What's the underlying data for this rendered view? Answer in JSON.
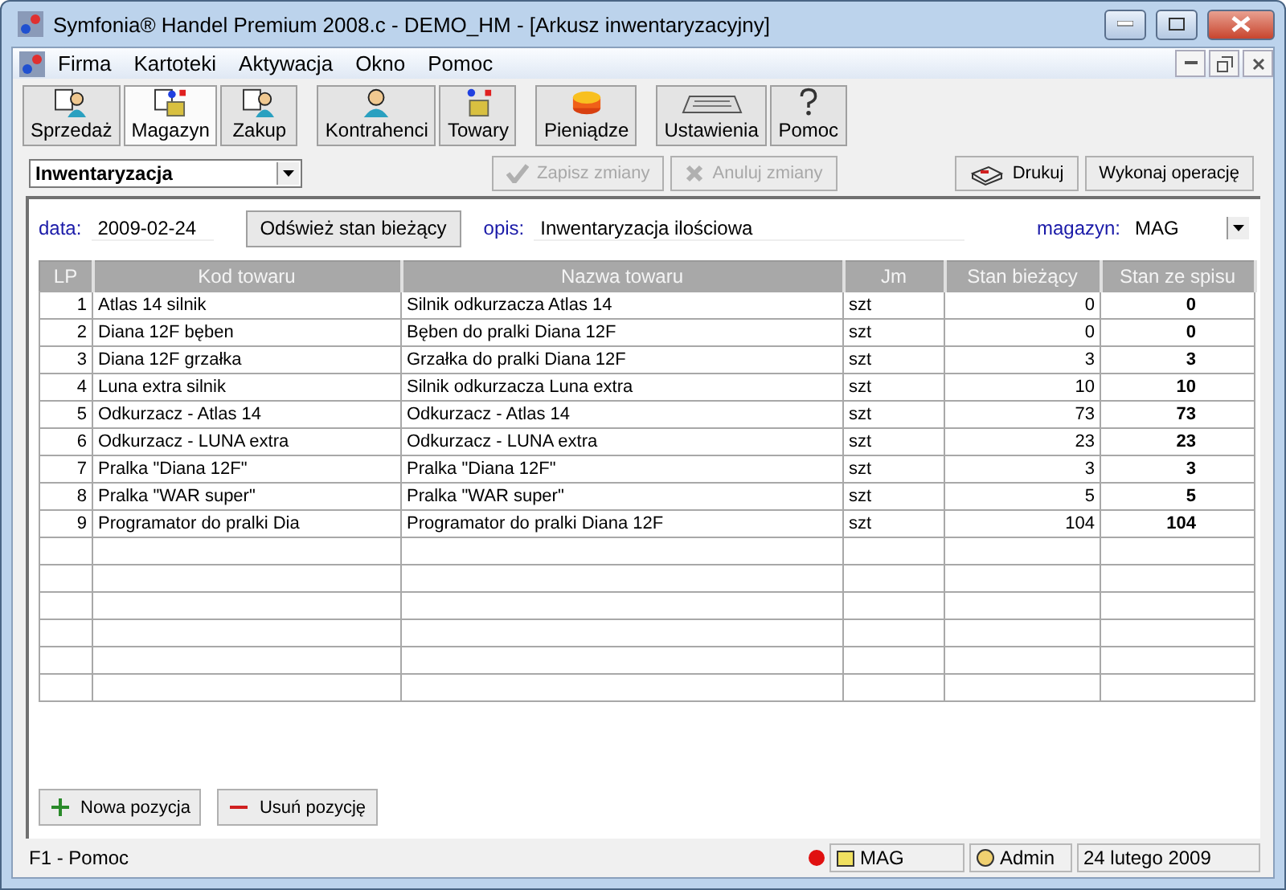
{
  "window": {
    "title": "Symfonia® Handel Premium 2008.c - DEMO_HM - [Arkusz inwentaryzacyjny]"
  },
  "menu": [
    "Firma",
    "Kartoteki",
    "Aktywacja",
    "Okno",
    "Pomoc"
  ],
  "toolbar": [
    {
      "buttons": [
        {
          "label": "Sprzedaż",
          "kind": "person-doc",
          "selected": false
        },
        {
          "label": "Magazyn",
          "kind": "box-doc",
          "selected": true
        },
        {
          "label": "Zakup",
          "kind": "person-doc",
          "selected": false
        }
      ]
    },
    {
      "buttons": [
        {
          "label": "Kontrahenci",
          "kind": "person",
          "selected": false
        },
        {
          "label": "Towary",
          "kind": "box",
          "selected": false
        }
      ]
    },
    {
      "buttons": [
        {
          "label": "Pieniądze",
          "kind": "money",
          "selected": false
        }
      ]
    },
    {
      "buttons": [
        {
          "label": "Ustawienia",
          "kind": "keyboard",
          "selected": false
        },
        {
          "label": "Pomoc",
          "kind": "help",
          "selected": false
        }
      ]
    }
  ],
  "operation": {
    "value": "Inwentaryzacja"
  },
  "actions": [
    {
      "label": "Zapisz zmiany",
      "kind": "save",
      "disabled": true
    },
    {
      "label": "Anuluj zmiany",
      "kind": "cancel",
      "disabled": true
    }
  ],
  "right_actions": [
    {
      "label": "Drukuj",
      "kind": "print",
      "disabled": false
    },
    {
      "label": "Wykonaj operację",
      "kind": "plain",
      "disabled": false
    }
  ],
  "form": {
    "date_label": "data:",
    "date": "2009-02-24",
    "refresh": "Odśwież stan bieżący",
    "desc_label": "opis:",
    "desc": "Inwentaryzacja ilościowa",
    "store_label": "magazyn:",
    "store": "MAG"
  },
  "table": {
    "columns": [
      "LP",
      "Kod towaru",
      "Nazwa towaru",
      "Jm",
      "Stan bieżący",
      "Stan ze spisu"
    ],
    "rows": [
      [
        "1",
        "Atlas 14 silnik",
        "Silnik odkurzacza Atlas 14",
        "szt",
        "0",
        "0"
      ],
      [
        "2",
        "Diana 12F bęben",
        "Bęben do pralki Diana 12F",
        "szt",
        "0",
        "0"
      ],
      [
        "3",
        "Diana 12F grzałka",
        "Grzałka do pralki Diana 12F",
        "szt",
        "3",
        "3"
      ],
      [
        "4",
        "Luna extra silnik",
        "Silnik odkurzacza Luna extra",
        "szt",
        "10",
        "10"
      ],
      [
        "5",
        "Odkurzacz - Atlas 14",
        "Odkurzacz - Atlas 14",
        "szt",
        "73",
        "73"
      ],
      [
        "6",
        "Odkurzacz - LUNA extra",
        "Odkurzacz - LUNA extra",
        "szt",
        "23",
        "23"
      ],
      [
        "7",
        "Pralka \"Diana 12F\"",
        "Pralka \"Diana 12F\"",
        "szt",
        "3",
        "3"
      ],
      [
        "8",
        "Pralka \"WAR super\"",
        "Pralka \"WAR super\"",
        "szt",
        "5",
        "5"
      ],
      [
        "9",
        "Programator do pralki Dia",
        "Programator do pralki Diana 12F",
        "szt",
        "104",
        "104"
      ]
    ]
  },
  "bottom_buttons": [
    {
      "label": "Nowa pozycja",
      "kind": "add"
    },
    {
      "label": "Usuń pozycję",
      "kind": "remove"
    }
  ],
  "status_bar": {
    "help": "F1 - Pomoc",
    "store": "MAG",
    "user": "Admin",
    "date": "24 lutego 2009"
  }
}
